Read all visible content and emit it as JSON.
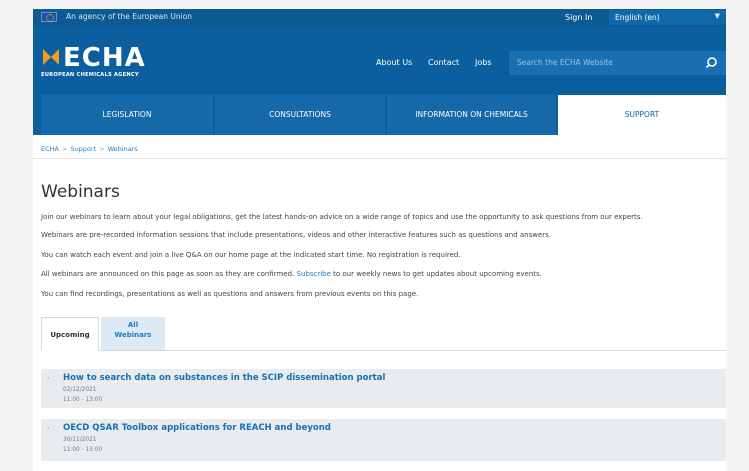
{
  "topbar": {
    "agency_text": "An agency of the European Union",
    "signin_label": "Sign In",
    "language_label": "English (en)"
  },
  "header": {
    "logo_text": "ECHA",
    "logo_subtitle": "EUROPEAN CHEMICALS AGENCY",
    "nav": [
      "About Us",
      "Contact",
      "Jobs"
    ],
    "search_placeholder": "Search the ECHA Website"
  },
  "mainnav": {
    "tabs": [
      "LEGISLATION",
      "CONSULTATIONS",
      "INFORMATION ON CHEMICALS",
      "SUPPORT"
    ],
    "active": "SUPPORT"
  },
  "breadcrumb": [
    "ECHA",
    "Support",
    "Webinars"
  ],
  "page_title": "Webinars",
  "paragraphs": {
    "p1": "Join our webinars to learn about your legal obligations, get the latest hands-on advice on a wide range of topics and use the opportunity to ask questions from our experts.",
    "p2": "Webinars are pre-recorded information sessions that include presentations, videos and other interactive features such as questions and answers.",
    "p3": "You can watch each event and join a live Q&A on our home page at the indicated start time. No registration is required.",
    "p4_before": "All webinars are announced on this page as soon as they are confirmed.",
    "p4_link": "Subscribe",
    "p4_after": "to our weekly news to get updates about upcoming events.",
    "p5": "You can find recordings, presentations as well as questions and answers from previous events on this page."
  },
  "subtabs": {
    "upcoming": "Upcoming",
    "all_line1": "All",
    "all_line2": "Webinars"
  },
  "webinars": [
    {
      "title": "How to search data on substances in the SCIP dissemination portal",
      "date": "02/12/2021",
      "time": "11:00 - 13:00"
    },
    {
      "title": "OECD QSAR Toolbox applications for REACH and beyond",
      "date": "30/11/2021",
      "time": "11:00 - 13:00"
    }
  ],
  "colors": {
    "brand_blue": "#0c5f9e",
    "link_blue": "#1a7bc2",
    "item_bg": "#e8ecef"
  }
}
